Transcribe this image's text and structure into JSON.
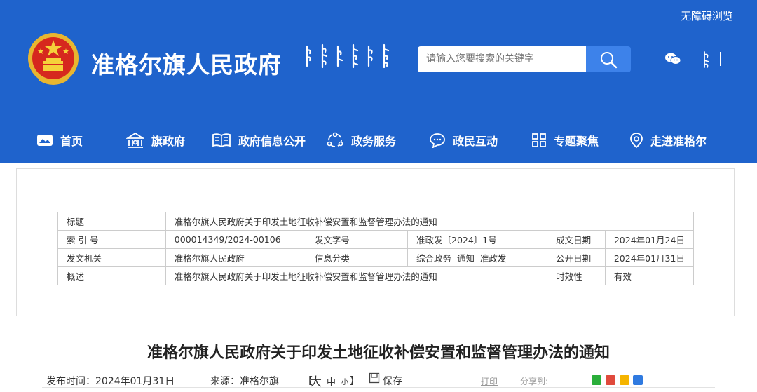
{
  "header": {
    "accessibility_label": "无障碍浏览",
    "site_title": "准格尔旗人民政府",
    "search_placeholder": "请输入您要搜索的关键字",
    "icons": [
      "national-emblem-icon",
      "search-icon",
      "wechat-icon",
      "mongolian-script-icon"
    ]
  },
  "nav": {
    "items": [
      {
        "label": "首页",
        "icon": "home-icon"
      },
      {
        "label": "旗政府",
        "icon": "government-building-icon"
      },
      {
        "label": "政府信息公开",
        "icon": "open-book-icon"
      },
      {
        "label": "政务服务",
        "icon": "services-icon"
      },
      {
        "label": "政民互动",
        "icon": "chat-icon"
      },
      {
        "label": "专题聚焦",
        "icon": "grid-icon"
      },
      {
        "label": "走进准格尔",
        "icon": "location-pin-icon"
      }
    ]
  },
  "meta_table": {
    "title_label": "标题",
    "title_value": "准格尔旗人民政府关于印发土地征收补偿安置和监督管理办法的通知",
    "index_label": "索 引 号",
    "index_value": "000014349/2024-00106",
    "doc_number_label": "发文字号",
    "doc_number_value": "准政发〔2024〕1号",
    "created_label": "成文日期",
    "created_value": "2024年01月24日",
    "issuer_label": "发文机关",
    "issuer_value": "准格尔旗人民政府",
    "category_label": "信息分类",
    "category_value": "综合政务  通知  准政发",
    "published_label": "公开日期",
    "published_value": "2024年01月31日",
    "summary_label": "概述",
    "summary_value": "准格尔旗人民政府关于印发土地征收补偿安置和监督管理办法的通知",
    "validity_label": "时效性",
    "validity_value": "有效"
  },
  "article": {
    "title": "准格尔旗人民政府关于印发土地征收补偿安置和监督管理办法的通知",
    "publish_time": "发布时间：2024年01月31日",
    "source": "来源：准格尔旗",
    "font_size_open": "【",
    "font_large": "大",
    "font_medium": "中",
    "font_small": "小",
    "font_size_close": "】",
    "save_label": "保存",
    "print_label": "打印",
    "share_label": "分享到:"
  },
  "colors": {
    "primary": "#1f63cc",
    "search_button": "#3d82ea",
    "share_wechat": "#2aae3a",
    "share_weibo": "#e04a3c",
    "share_qzone": "#f5b400",
    "share_app": "#2f7ae0"
  }
}
